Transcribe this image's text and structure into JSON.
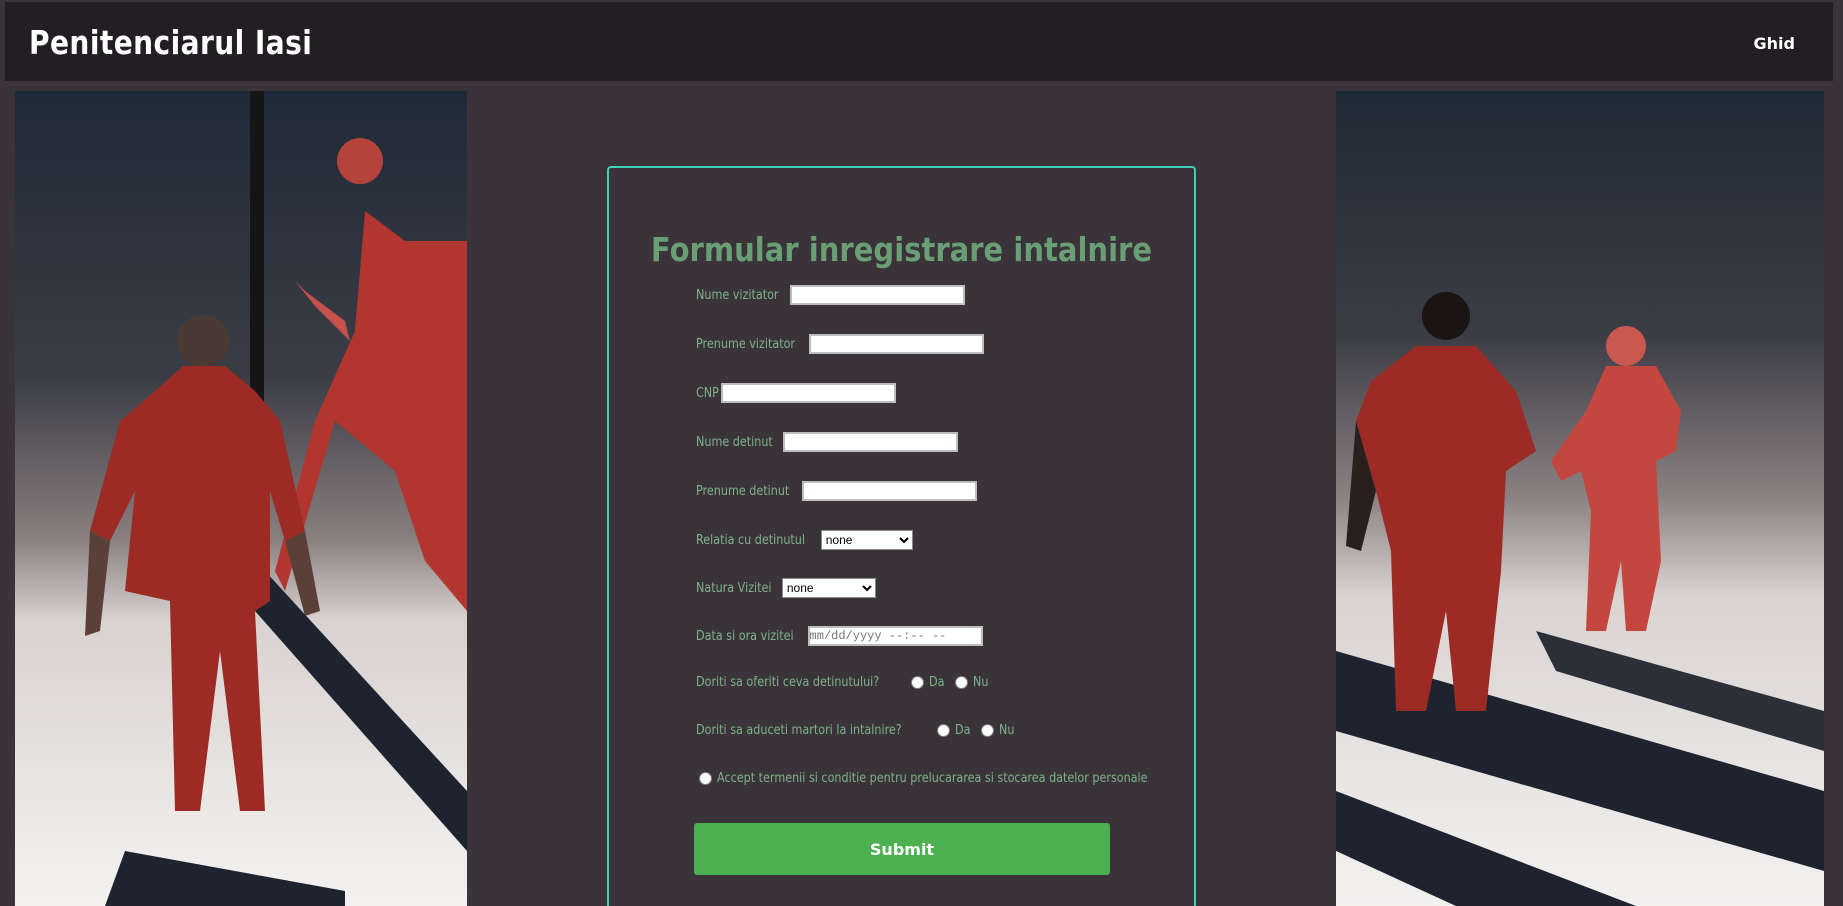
{
  "header": {
    "brand": "Penitenciarul Iasi",
    "nav_link": "Ghid"
  },
  "form": {
    "title": "Formular inregistrare intalnire",
    "fields": {
      "nume_vizitator": {
        "label": "Nume vizitator",
        "value": ""
      },
      "prenume_vizitator": {
        "label": "Prenume vizitator",
        "value": ""
      },
      "cnp": {
        "label": "CNP",
        "value": ""
      },
      "nume_detinut": {
        "label": "Nume detinut",
        "value": ""
      },
      "prenume_detinut": {
        "label": "Prenume detinut",
        "value": ""
      },
      "relatia": {
        "label": "Relatia cu detinutul",
        "selected": "none"
      },
      "natura": {
        "label": "Natura Vizitei",
        "selected": "none"
      },
      "data_ora": {
        "label": "Data si ora vizitei",
        "placeholder": "mm/dd/yyyy --:-- --"
      }
    },
    "q_oferiti": {
      "label": "Doriti sa oferiti ceva detinutului?",
      "yes": "Da",
      "no": "Nu"
    },
    "q_martori": {
      "label": "Doriti sa aduceti martori la intalnire?",
      "yes": "Da",
      "no": "Nu"
    },
    "terms": "Accept termenii si conditie pentru prelucararea si stocarea datelor personale",
    "submit": "Submit"
  },
  "colors": {
    "page_bg": "#3a3339",
    "topbar_bg": "#231e24",
    "card_border": "#3fd1b6",
    "label_green": "#7fb28a",
    "title_green": "#6a9f75",
    "submit_green": "#4caf50"
  }
}
